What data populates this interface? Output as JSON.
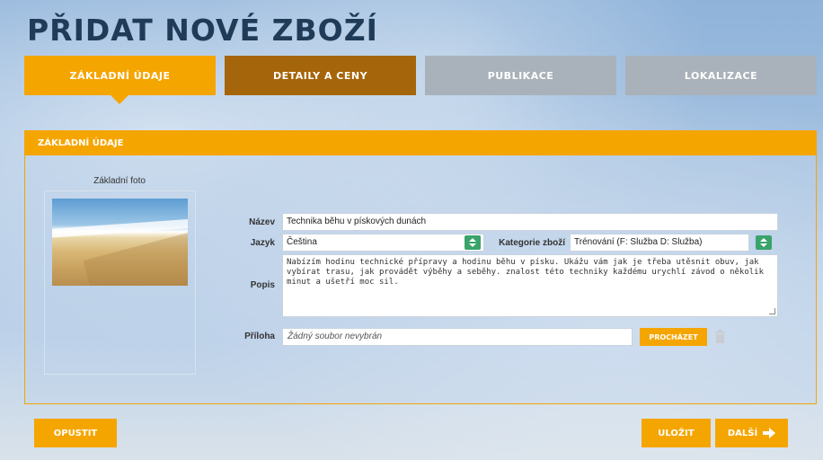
{
  "page": {
    "title": "PŘIDAT NOVÉ ZBOŽÍ"
  },
  "tabs": [
    {
      "label": "ZÁKLADNÍ ÚDAJE"
    },
    {
      "label": "DETAILY A CENY"
    },
    {
      "label": "PUBLIKACE"
    },
    {
      "label": "LOKALIZACE"
    }
  ],
  "panel": {
    "header": "ZÁKLADNÍ ÚDAJE",
    "photo_label": "Základní foto"
  },
  "form": {
    "name_label": "Název",
    "name_value": "Technika běhu v pískových dunách",
    "language_label": "Jazyk",
    "language_value": "Čeština",
    "category_label": "Kategorie zboží",
    "category_value": "Trénování (F: Služba D: Služba)",
    "description_label": "Popis",
    "description_value": "Nabízím hodinu technické přípravy a hodinu běhu v písku. Ukážu vám jak je třeba utěsnit obuv, jak vybírat trasu, jak provádět výběhy a seběhy. znalost této techniky každému urychlí závod o několik minut a ušetří moc sil.",
    "attachment_label": "Příloha",
    "attachment_value": "Žádný soubor nevybrán",
    "browse_label": "PROCHÁZET"
  },
  "footer": {
    "cancel_label": "OPUSTIT",
    "save_label": "ULOŽIT",
    "next_label": "DALŠÍ"
  },
  "colors": {
    "accent": "#f5a500",
    "tab_secondary": "#a5650a",
    "tab_inactive": "#a9b2ba",
    "title": "#1f3b57"
  },
  "icons": {
    "select_arrow": "up-down-chevron-icon",
    "trash": "trash-icon",
    "next": "arrow-right-icon"
  }
}
